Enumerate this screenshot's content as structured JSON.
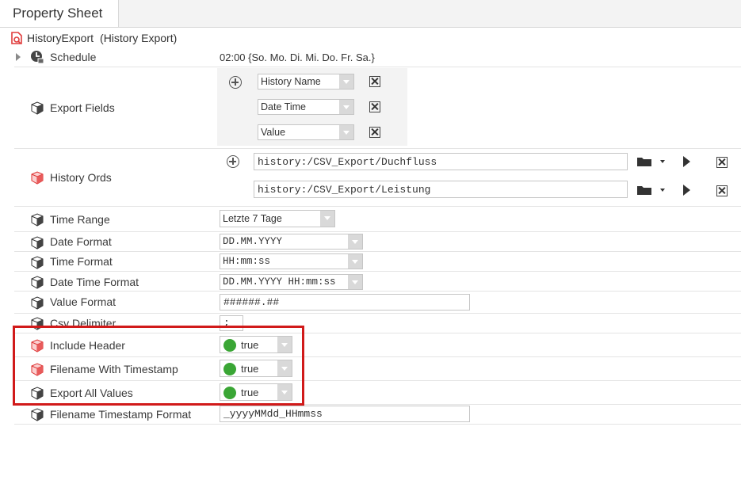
{
  "tab": {
    "label": "Property Sheet"
  },
  "root": {
    "name": "HistoryExport",
    "type": "(History Export)"
  },
  "schedule": {
    "label": "Schedule",
    "value": "02:00 {So. Mo. Di. Mi. Do. Fr. Sa.}"
  },
  "export_fields": {
    "label": "Export Fields",
    "items": [
      "History Name",
      "Date Time",
      "Value"
    ]
  },
  "history_ords": {
    "label": "History Ords",
    "items": [
      "history:/CSV_Export/Duchfluss",
      "history:/CSV_Export/Leistung"
    ]
  },
  "time_range": {
    "label": "Time Range",
    "value": "Letzte 7 Tage"
  },
  "date_format": {
    "label": "Date Format",
    "value": "DD.MM.YYYY"
  },
  "time_format": {
    "label": "Time Format",
    "value": "HH:mm:ss"
  },
  "date_time_format": {
    "label": "Date Time Format",
    "value": "DD.MM.YYYY HH:mm:ss"
  },
  "value_format": {
    "label": "Value Format",
    "value": "######.##"
  },
  "csv_delimiter": {
    "label": "Csv Delimiter",
    "value": ";"
  },
  "include_header": {
    "label": "Include Header",
    "value": "true"
  },
  "filename_with_timestamp": {
    "label": "Filename With Timestamp",
    "value": "true"
  },
  "export_all_values": {
    "label": "Export All Values",
    "value": "true"
  },
  "filename_timestamp_format": {
    "label": "Filename Timestamp Format",
    "value": "_yyyyMMdd_HHmmss"
  },
  "colors": {
    "highlight": "#d11a1a",
    "true_dot": "#3aa635",
    "icon_red": "#e85b5b"
  }
}
